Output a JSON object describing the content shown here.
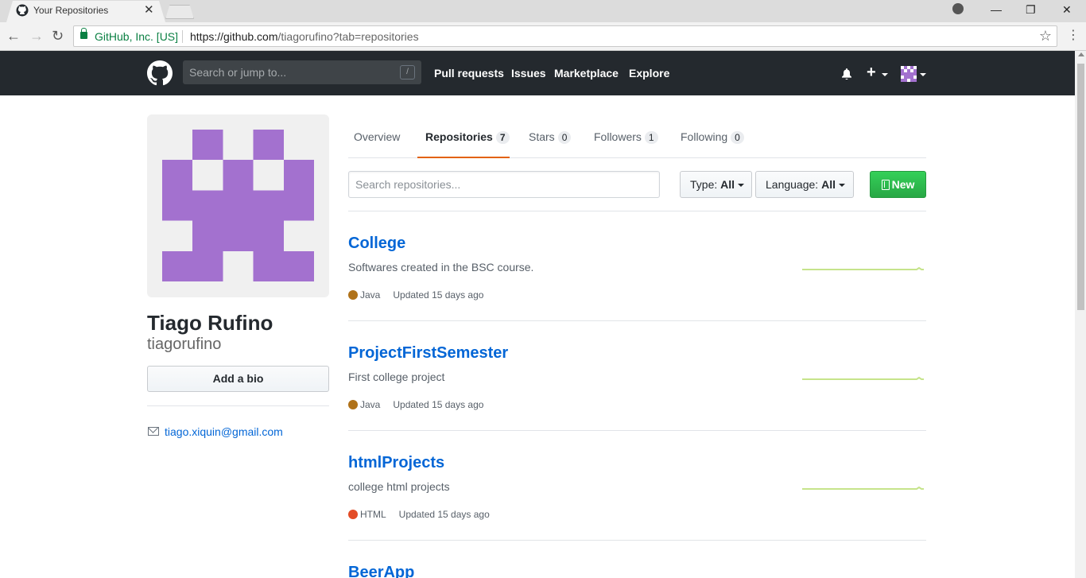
{
  "browser": {
    "tab_title": "Your Repositories",
    "secure_label": "GitHub, Inc. [US]",
    "url_host": "https://github.com",
    "url_path": "/tiagorufino?tab=repositories"
  },
  "header": {
    "search_placeholder": "Search or jump to...",
    "search_shortcut": "/",
    "nav": [
      "Pull requests",
      "Issues",
      "Marketplace",
      "Explore"
    ]
  },
  "profile": {
    "full_name": "Tiago Rufino",
    "username": "tiagorufino",
    "bio_button": "Add a bio",
    "email": "tiago.xiquin@gmail.com",
    "avatar_color": "#a371cf"
  },
  "tabs": [
    {
      "label": "Overview",
      "count": null
    },
    {
      "label": "Repositories",
      "count": "7",
      "active": true
    },
    {
      "label": "Stars",
      "count": "0"
    },
    {
      "label": "Followers",
      "count": "1"
    },
    {
      "label": "Following",
      "count": "0"
    }
  ],
  "filters": {
    "search_placeholder": "Search repositories...",
    "type_label": "Type:",
    "type_value": "All",
    "language_label": "Language:",
    "language_value": "All",
    "new_button": "New"
  },
  "repos": [
    {
      "name": "College",
      "description": "Softwares created in the BSC course.",
      "language": "Java",
      "language_color": "#b07219",
      "updated": "Updated 15 days ago"
    },
    {
      "name": "ProjectFirstSemester",
      "description": "First college project",
      "language": "Java",
      "language_color": "#b07219",
      "updated": "Updated 15 days ago"
    },
    {
      "name": "htmlProjects",
      "description": "college html projects",
      "language": "HTML",
      "language_color": "#e34c26",
      "updated": "Updated 15 days ago"
    },
    {
      "name": "BeerApp"
    }
  ],
  "colors": {
    "header_bg": "#24292e",
    "link": "#0366d6",
    "active_tab_border": "#e36209",
    "new_button": "#28a745",
    "sparkline": "#c6e48b"
  }
}
